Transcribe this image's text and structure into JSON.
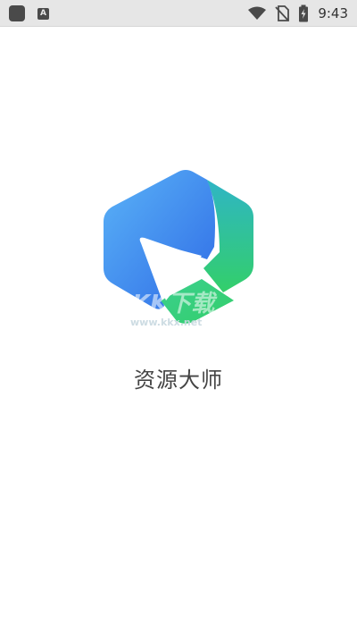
{
  "status_bar": {
    "time": "9:43",
    "icons": [
      "notification-square-icon",
      "keyboard-a-icon",
      "wifi-icon",
      "no-sim-icon",
      "battery-charging-icon"
    ],
    "small_badge_letter": "A"
  },
  "splash": {
    "app_name": "资源大师",
    "logo_icon": "hexagon-play-logo-icon",
    "logo_colors": {
      "blue_light": "#5ab3f7",
      "blue_dark": "#2f6be6",
      "teal": "#2fb5c5",
      "green": "#33cf6a"
    }
  },
  "watermark": {
    "brand": "KK下载",
    "url": "www.kkx.net"
  }
}
